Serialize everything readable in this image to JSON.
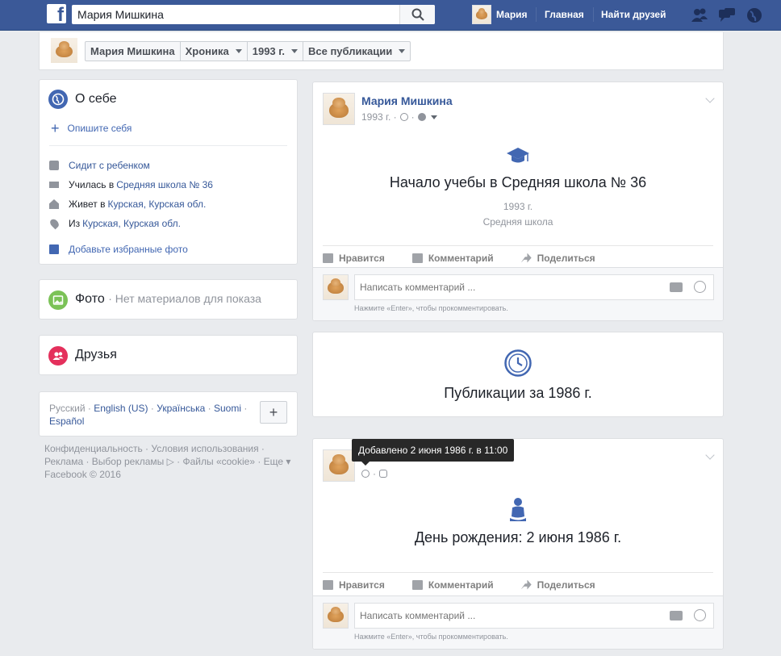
{
  "topbar": {
    "search_value": "Мария Мишкина",
    "user_name": "Мария",
    "home_label": "Главная",
    "find_friends_label": "Найти друзей"
  },
  "subbar": {
    "crumbs": [
      "Мария Мишкина",
      "Хроника",
      "1993 г.",
      "Все публикации"
    ]
  },
  "about": {
    "title": "О себе",
    "describe_link": "Опишите себя",
    "rows": {
      "status": "Сидит с ребенком",
      "studied_pre": "Училась в",
      "studied_link": "Средняя школа № 36",
      "lives_pre": "Живет в",
      "lives_link": "Курская, Курская обл.",
      "from_pre": "Из",
      "from_link": "Курская, Курская обл."
    },
    "add_photos_link": "Добавьте избранные фото"
  },
  "photos": {
    "title": "Фото",
    "subtitle": "· Нет материалов для показа"
  },
  "friends": {
    "title": "Друзья"
  },
  "languages": {
    "items": [
      "Русский",
      "English (US)",
      "Українська",
      "Suomi",
      "Español"
    ],
    "add_label": "+"
  },
  "footer": {
    "line1": "Конфиденциальность · Условия использования ·",
    "line2": "Реклама · Выбор рекламы ▷ · Файлы «cookie» · Еще ▾",
    "line3": "Facebook © 2016"
  },
  "post1": {
    "author": "Мария Мишкина",
    "meta_year": "1993 г. ·",
    "event_title": "Начало учебы в Средняя школа № 36",
    "event_year": "1993 г.",
    "event_type": "Средняя школа",
    "like": "Нравится",
    "comment": "Комментарий",
    "share": "Поделиться",
    "comment_placeholder": "Написать комментарий ...",
    "hint": "Нажмите «Enter», чтобы прокомментировать."
  },
  "period": {
    "title": "Публикации за 1986 г."
  },
  "post2": {
    "tooltip": "Добавлено 2 июня 1986 г. в 11:00",
    "event_title": "День рождения: 2 июня 1986 г.",
    "like": "Нравится",
    "comment": "Комментарий",
    "share": "Поделиться",
    "comment_placeholder": "Написать комментарий ...",
    "hint": "Нажмите «Enter», чтобы прокомментировать."
  },
  "colors": {
    "brand": "#3b5998",
    "link": "#365899",
    "background": "#e9ebee"
  }
}
